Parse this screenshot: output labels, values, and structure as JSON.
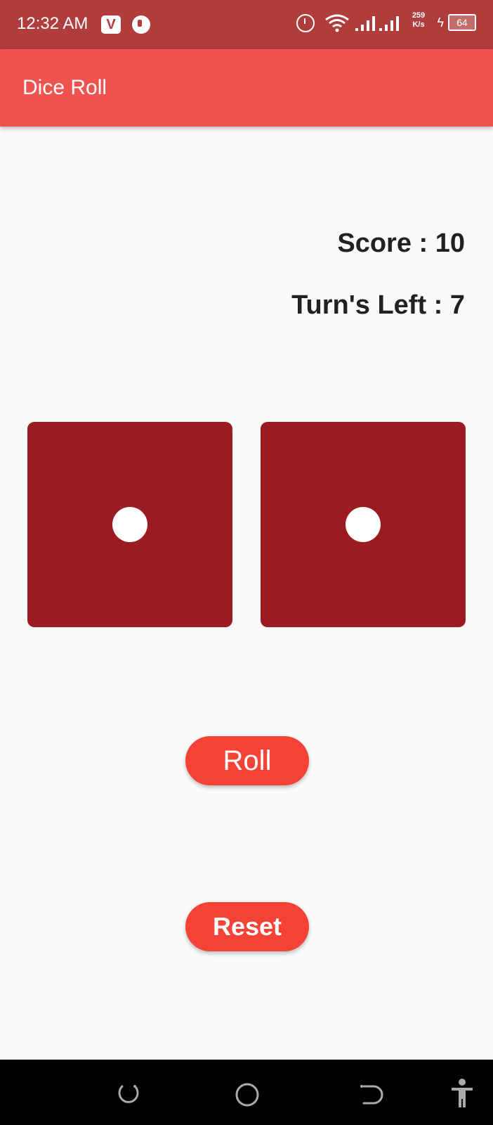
{
  "status_bar": {
    "time": "12:32 AM",
    "app_icon_1": "V",
    "speed_value": "259",
    "speed_unit": "K/s",
    "battery": "64",
    "icons": [
      "alarm-icon",
      "wifi-icon",
      "signal-icon",
      "charging-icon",
      "battery-icon"
    ]
  },
  "app_bar": {
    "title": "Dice Roll"
  },
  "game": {
    "score_text": "Score : 10",
    "turns_text": "Turn's Left : 7",
    "dice": [
      1,
      1
    ]
  },
  "buttons": {
    "roll_label": "Roll",
    "reset_label": "Reset"
  },
  "colors": {
    "status_bar": "#b03c3c",
    "app_bar": "#ef5350",
    "die": "#9a1c20",
    "button": "#f44336"
  },
  "nav": {
    "icons": [
      "recent-apps-icon",
      "home-icon",
      "back-icon",
      "accessibility-icon"
    ]
  }
}
